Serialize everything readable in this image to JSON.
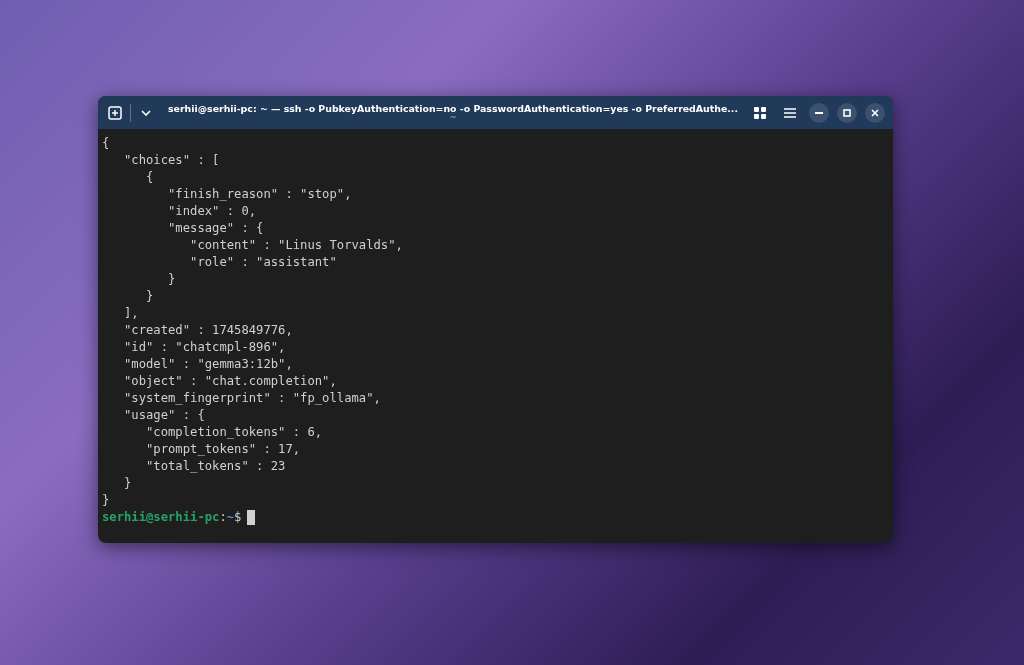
{
  "window": {
    "title": "serhii@serhii-pc: ~ — ssh -o PubkeyAuthentication=no -o PasswordAuthentication=yes -o PreferredAuthe...",
    "subtitle": "~"
  },
  "terminal": {
    "lines": [
      "{",
      "   \"choices\" : [",
      "      {",
      "         \"finish_reason\" : \"stop\",",
      "         \"index\" : 0,",
      "         \"message\" : {",
      "            \"content\" : \"Linus Torvalds\",",
      "            \"role\" : \"assistant\"",
      "         }",
      "      }",
      "   ],",
      "   \"created\" : 1745849776,",
      "   \"id\" : \"chatcmpl-896\",",
      "   \"model\" : \"gemma3:12b\",",
      "   \"object\" : \"chat.completion\",",
      "   \"system_fingerprint\" : \"fp_ollama\",",
      "   \"usage\" : {",
      "      \"completion_tokens\" : 6,",
      "      \"prompt_tokens\" : 17,",
      "      \"total_tokens\" : 23",
      "   }",
      "}"
    ],
    "prompt": {
      "user_host": "serhii@serhii-pc",
      "separator": ":",
      "path": "~",
      "symbol": "$"
    }
  }
}
